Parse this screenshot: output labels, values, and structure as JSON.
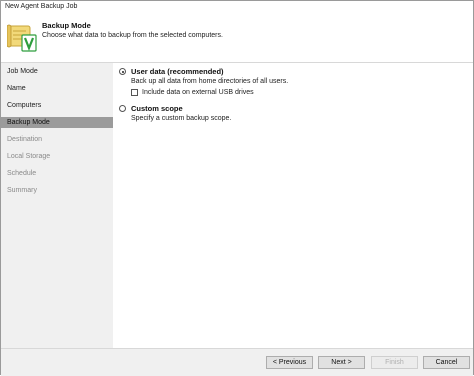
{
  "window": {
    "title": "New Agent Backup Job"
  },
  "header": {
    "icon": "backup-scroll-icon",
    "title": "Backup Mode",
    "description": "Choose what data to backup from the selected computers."
  },
  "sidebar": {
    "items": [
      {
        "label": "Job Mode",
        "state": "enabled"
      },
      {
        "label": "Name",
        "state": "enabled"
      },
      {
        "label": "Computers",
        "state": "enabled"
      },
      {
        "label": "Backup Mode",
        "state": "selected"
      },
      {
        "label": "Destination",
        "state": "disabled"
      },
      {
        "label": "Local Storage",
        "state": "disabled"
      },
      {
        "label": "Schedule",
        "state": "disabled"
      },
      {
        "label": "Summary",
        "state": "disabled"
      }
    ]
  },
  "options": {
    "user_data": {
      "label": "User data (recommended)",
      "description": "Back up all data from home directories of all users.",
      "selected": true,
      "usb_checkbox": {
        "label": "Include data on external USB drives",
        "checked": false
      }
    },
    "custom_scope": {
      "label": "Custom scope",
      "description": "Specify a custom backup scope.",
      "selected": false
    }
  },
  "footer": {
    "previous": "< Previous",
    "next": "Next >",
    "finish": "Finish",
    "cancel": "Cancel"
  },
  "colors": {
    "sidebar_bg": "#f0f0f0",
    "selected_item": "#9b9b9b",
    "icon_check": "#2e9e3e"
  }
}
